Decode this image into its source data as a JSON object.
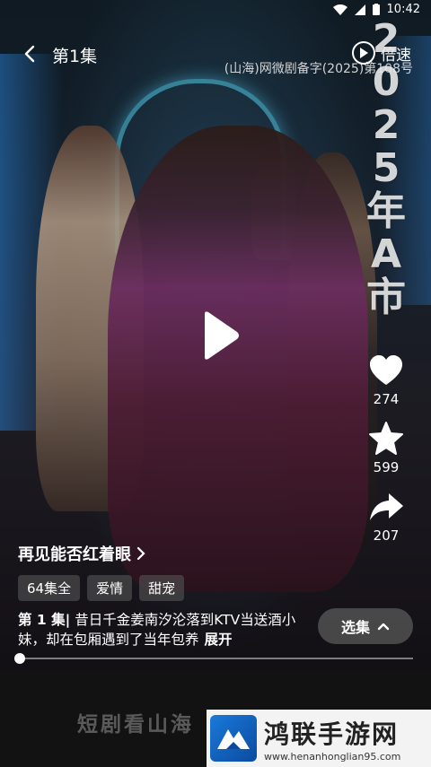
{
  "status_bar": {
    "time": "10:42"
  },
  "top_bar": {
    "episode_title": "第1集",
    "speed_label": "倍速",
    "license_text": "(山海)网微剧备字(2025)第108号"
  },
  "overlay_watermark": [
    "2",
    "0",
    "2",
    "5",
    "年",
    "A",
    "市"
  ],
  "actions": {
    "like_count": "274",
    "favorite_count": "599",
    "share_count": "207"
  },
  "drama": {
    "title": "再见能否红着眼",
    "tags": [
      "64集全",
      "爱情",
      "甜宠"
    ],
    "episode_label": "第 1 集",
    "episode_separator": "|",
    "description": "昔日千金姜南汐沦落到KTV当送酒小妹，却在包厢遇到了当年包养",
    "expand_label": "展开",
    "select_episode_label": "选集"
  },
  "progress": {
    "value": 0.0
  },
  "bottom": {
    "slogan": "短剧看山海"
  },
  "site_badge": {
    "name": "鸿联手游网",
    "url": "www.henanhonglian95.com"
  }
}
